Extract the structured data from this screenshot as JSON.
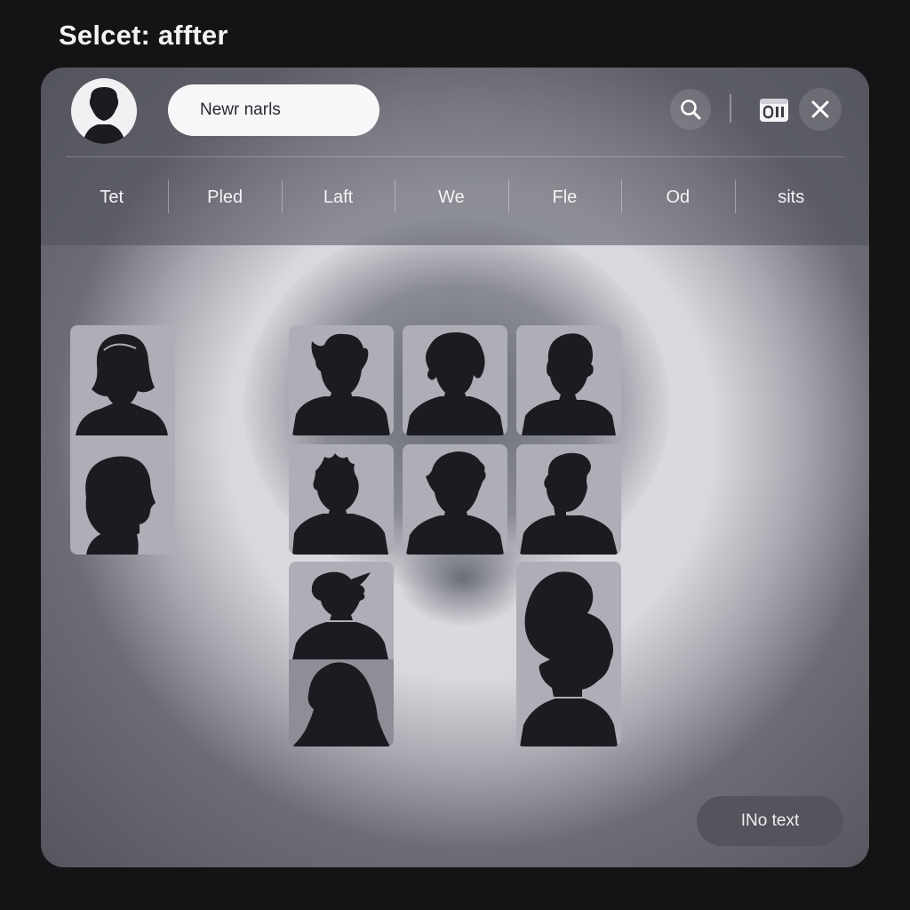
{
  "page": {
    "title": "Selcet: affter"
  },
  "header": {
    "avatar_icon": "person-silhouette-icon",
    "search": {
      "value": "Newr narls",
      "placeholder": ""
    },
    "actions": [
      {
        "icon": "search-icon"
      },
      {
        "icon": "camera-icon"
      },
      {
        "icon": "close-icon"
      }
    ]
  },
  "tabs": [
    {
      "label": "Tet"
    },
    {
      "label": "Pled"
    },
    {
      "label": "Laft"
    },
    {
      "label": "We"
    },
    {
      "label": "Fle"
    },
    {
      "label": "Od"
    },
    {
      "label": "sits"
    }
  ],
  "grid": {
    "tiles": [
      {
        "icon": "person-bob-hair-icon"
      },
      {
        "icon": "person-profile-icon"
      },
      {
        "icon": "person-spiky-hair-icon"
      },
      {
        "icon": "person-wavy-hair-icon"
      },
      {
        "icon": "person-short-hair-icon"
      },
      {
        "icon": "person-messy-hair-icon"
      },
      {
        "icon": "person-pointed-hair-icon"
      },
      {
        "icon": "person-bearded-icon"
      },
      {
        "icon": "person-windswept-hair-icon"
      },
      {
        "icon": "person-long-hair-profile-icon"
      },
      {
        "icon": "person-tall-hair-icon"
      }
    ]
  },
  "footer": {
    "button_label": "INo text"
  },
  "colors": {
    "background": "#141416",
    "header": "#4e505a",
    "tile": "#aeaeb6",
    "silhouette": "#1b1c21"
  }
}
